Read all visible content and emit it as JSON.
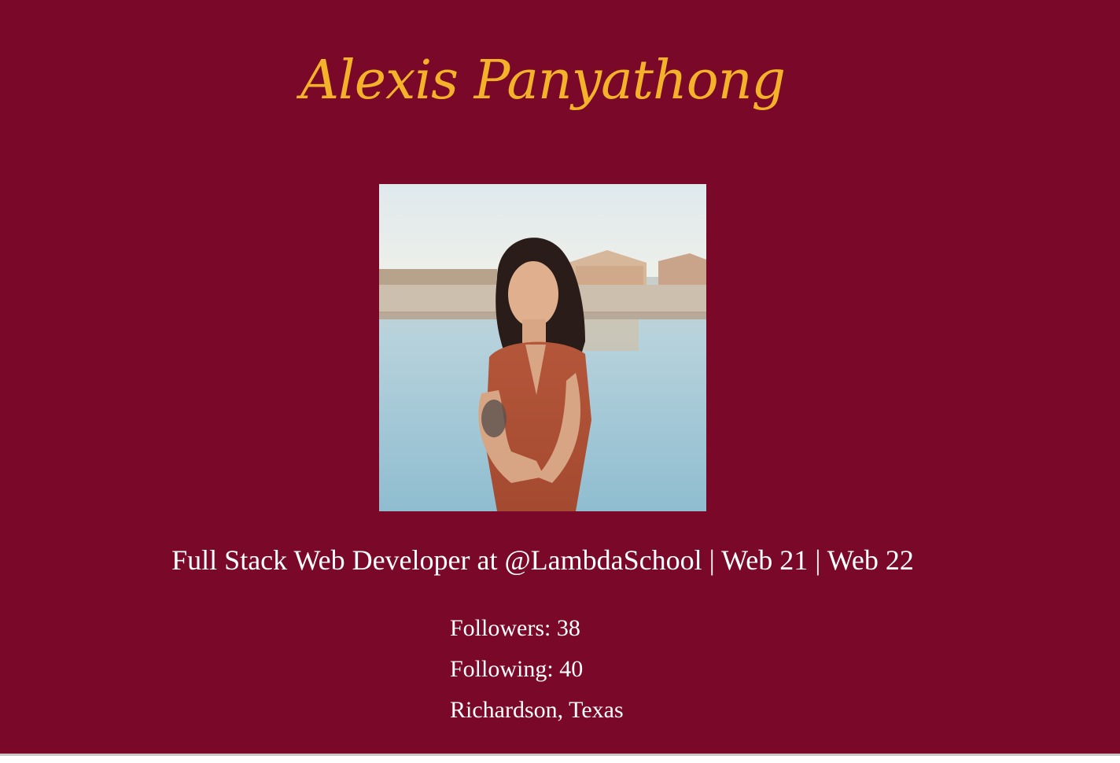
{
  "profile": {
    "name": "Alexis Panyathong",
    "photo_alt": "profile-photo",
    "bio": "Full Stack Web Developer at @LambdaSchool | Web 21 | Web 22",
    "followers": "Followers: 38",
    "following": "Following: 40",
    "location": "Richardson, Texas"
  },
  "colors": {
    "background": "#7a0829",
    "name": "#f3b22a",
    "text": "#ffffff"
  }
}
